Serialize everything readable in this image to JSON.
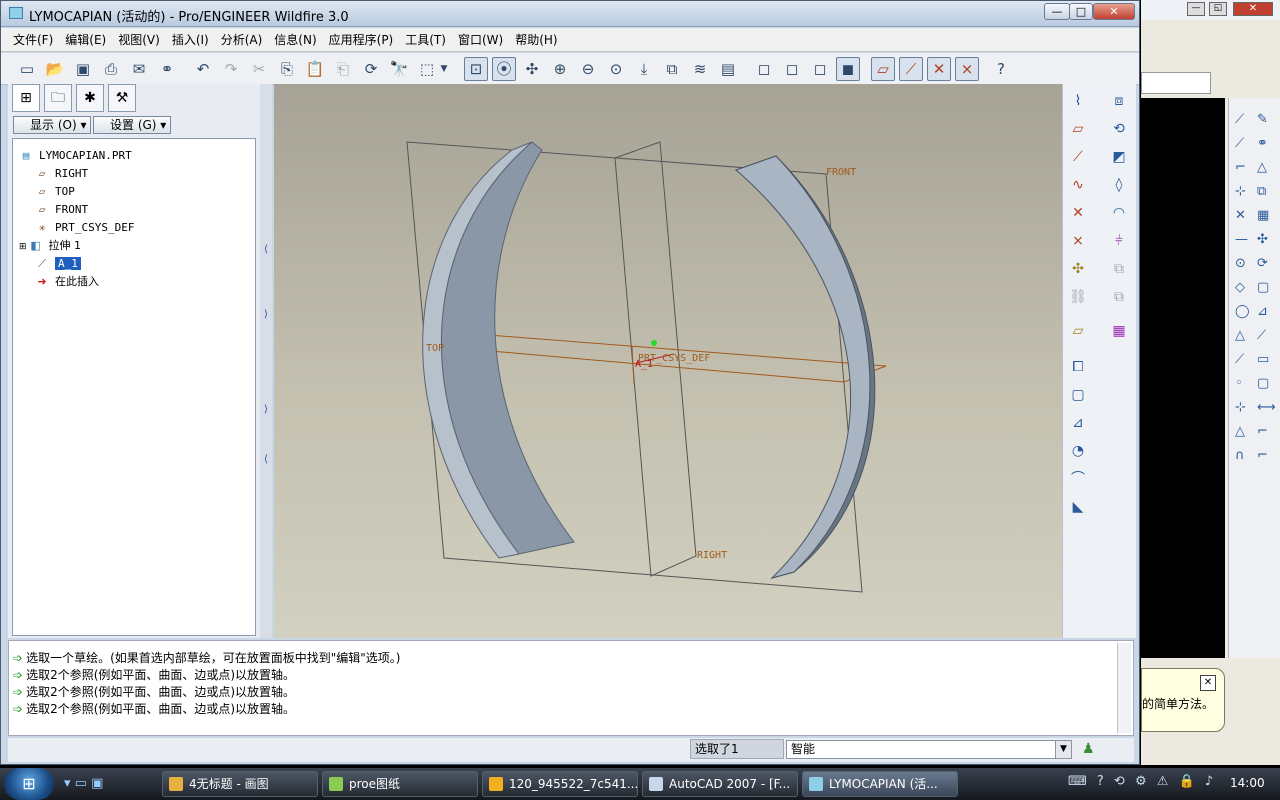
{
  "window": {
    "title": "LYMOCAPIAN (活动的) - Pro/ENGINEER Wildfire 3.0",
    "controls": [
      "—",
      "□",
      "✕"
    ]
  },
  "menu": [
    "文件(F)",
    "编辑(E)",
    "视图(V)",
    "插入(I)",
    "分析(A)",
    "信息(N)",
    "应用程序(P)",
    "工具(T)",
    "窗口(W)",
    "帮助(H)"
  ],
  "left_panel": {
    "display_btn": "显示 (O)",
    "settings_btn": "设置 (G)",
    "tree": [
      {
        "label": "LYMOCAPIAN.PRT",
        "icon": "part-icon"
      },
      {
        "label": "RIGHT",
        "icon": "datum-plane-icon"
      },
      {
        "label": "TOP",
        "icon": "datum-plane-icon"
      },
      {
        "label": "FRONT",
        "icon": "datum-plane-icon"
      },
      {
        "label": "PRT_CSYS_DEF",
        "icon": "csys-icon"
      },
      {
        "label": "拉伸 1",
        "icon": "extrude-icon"
      },
      {
        "label": "A_1",
        "icon": "axis-icon"
      },
      {
        "label": "在此插入",
        "icon": "insert-arrow-icon"
      }
    ]
  },
  "viewport": {
    "labels": {
      "front": "FRONT",
      "top": "TOP",
      "right": "RIGHT",
      "csys": "PRT_CSYS_DEF",
      "axis": "A_1"
    }
  },
  "messages": [
    "选取一个草绘。(如果首选内部草绘，可在放置面板中找到\"编辑\"选项。)",
    "选取2个参照(例如平面、曲面、边或点)以放置轴。",
    "选取2个参照(例如平面、曲面、边或点)以放置轴。",
    "选取2个参照(例如平面、曲面、边或点)以放置轴。"
  ],
  "status": {
    "selected": "选取了1",
    "filter": "智能"
  },
  "background_tooltip": "的简单方法。",
  "taskbar": {
    "tasks": [
      {
        "label": "4无标题 - 画图",
        "color": "#e8b040"
      },
      {
        "label": "proe图纸",
        "color": "#8acb52"
      },
      {
        "label": "120_945522_7c541...",
        "color": "#f0b020"
      },
      {
        "label": "AutoCAD 2007 - [F...",
        "color": "#c8d8ea"
      },
      {
        "label": "LYMOCAPIAN (活...",
        "color": "#8fd0e8"
      }
    ],
    "clock": "14:00"
  }
}
